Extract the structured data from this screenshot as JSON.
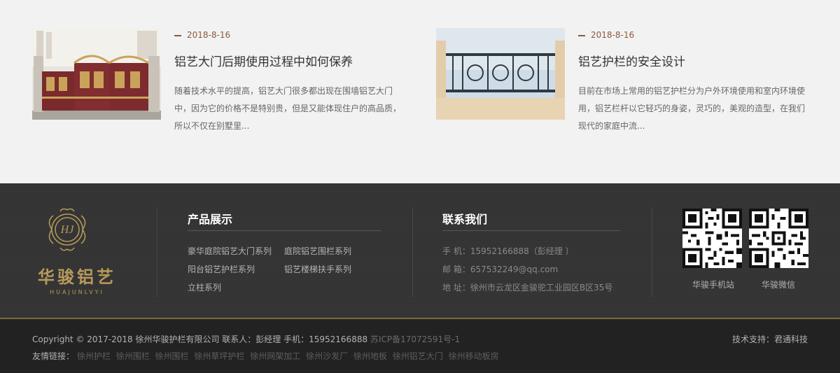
{
  "news": [
    {
      "date": "2018-8-16",
      "title": "铝艺大门后期使用过程中如何保养",
      "desc": "随着技术水平的提高，铝艺大门很多都出现在围墙铝艺大门中，因为它的价格不是特别贵，但是又能体现住户的高品质，所以不仅在别墅里..."
    },
    {
      "date": "2018-8-16",
      "title": "铝艺护栏的安全设计",
      "desc": "目前在市场上常用的铝艺护栏分为户外环境使用和室内环境使用，铝艺栏杆以它轻巧的身姿，灵巧的，美观的造型，在我们现代的家庭中流..."
    }
  ],
  "footer": {
    "logo": {
      "cn": "华骏铝艺",
      "en": "HUAJUNLVYI",
      "mono": "HJ"
    },
    "products": {
      "title": "产品展示",
      "items": [
        "豪华庭院铝艺大门系列",
        "庭院铝艺围栏系列",
        "阳台铝艺护栏系列",
        "铝艺楼梯扶手系列",
        "立柱系列"
      ]
    },
    "contact": {
      "title": "联系我们",
      "phone": "手 机：15952166888（彭经理 ）",
      "email": "邮 箱：657532249@qq.com",
      "address": "地 址：徐州市云龙区金骏驼工业园区B区35号"
    },
    "qr": [
      {
        "label": "华骏手机站"
      },
      {
        "label": "华骏微信"
      }
    ]
  },
  "bottom": {
    "copyright": "Copyright © 2017-2018 徐州华骏护栏有限公司 联系人：彭经理 手机：15952166888",
    "icp": "苏ICP备17072591号-1",
    "support": "技术支持：君通科技",
    "friends_label": "友情链接：",
    "friends": [
      "徐州护栏",
      "徐州围栏",
      "徐州围栏",
      "徐州草坪护栏",
      "徐州网架加工",
      "徐州沙发厂",
      "徐州地板",
      "徐州铝艺大门",
      "徐州移动板房"
    ]
  },
  "colors": {
    "accent": "#8b5a3c",
    "gold": "#b89a5a",
    "footer_bg": "#333333",
    "bottom_bg": "#222222"
  }
}
